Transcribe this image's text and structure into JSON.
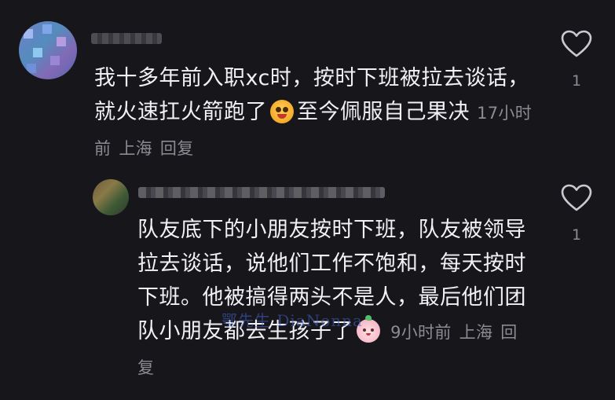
{
  "comments": [
    {
      "text_before_emoji": "我十多年前入职xc时，按时下班被拉去谈话，就火速扛火箭跑了",
      "emoji": "grinning-face-emoji",
      "text_after_emoji": "至今佩服自己果决",
      "time": "17小时前",
      "location": "上海",
      "reply_label": "回复",
      "like_count": "1",
      "like_icon": "heart-outline-icon"
    },
    {
      "text_before_emoji": "队友底下的小朋友按时下班，队友被领导拉去谈话，说他们工作不饱和，每天按时下班。他被搞得两头不是人，最后他们团队小朋友都去生孩子了",
      "emoji": "peach-face-emoji",
      "time": "9小时前",
      "location": "上海",
      "reply_label": "回复",
      "like_count": "1",
      "like_icon": "heart-outline-icon"
    }
  ],
  "watermark": "鄂先生 DiaNonna",
  "colors": {
    "background": "#16161b",
    "text": "#f1f1f3",
    "meta": "#8b8b92"
  }
}
